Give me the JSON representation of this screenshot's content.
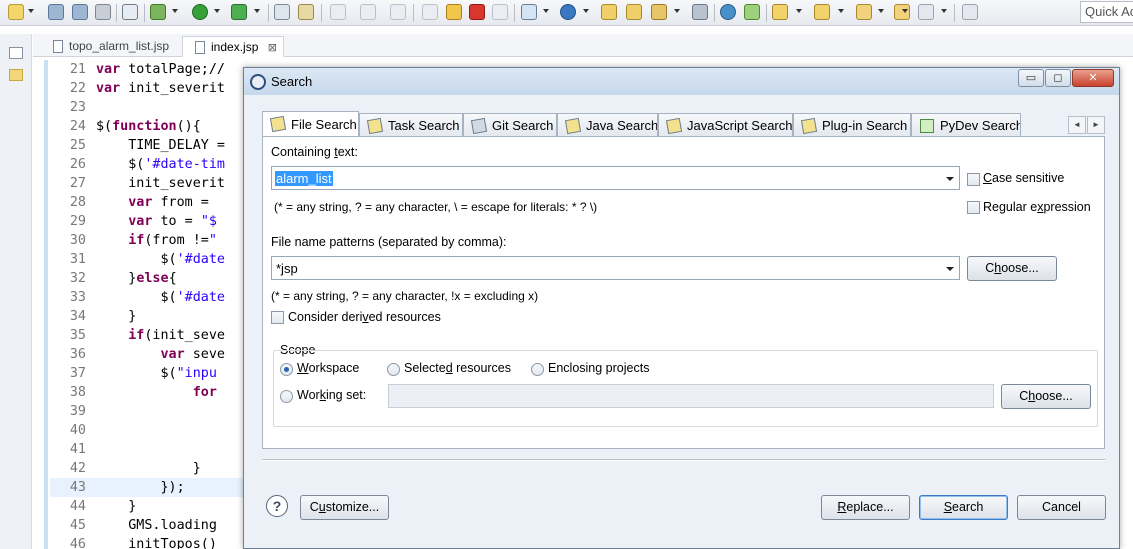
{
  "toolbar": {
    "quick_access": "Quick Ac"
  },
  "editor": {
    "tabs": [
      {
        "label": "topo_alarm_list.jsp"
      },
      {
        "label": "index.jsp",
        "close": "⊠"
      }
    ],
    "lines": [
      {
        "num": "21",
        "code": "var totalPage;//"
      },
      {
        "num": "22",
        "code": "var init_severit"
      },
      {
        "num": "23",
        "code": ""
      },
      {
        "num": "24",
        "code": "$(function(){"
      },
      {
        "num": "25",
        "code": "    TIME_DELAY ="
      },
      {
        "num": "26",
        "code": "    $('#date-tim"
      },
      {
        "num": "27",
        "code": "    init_severit"
      },
      {
        "num": "28",
        "code": "    var from ="
      },
      {
        "num": "29",
        "code": "    var to = \"$"
      },
      {
        "num": "30",
        "code": "    if(from !=\""
      },
      {
        "num": "31",
        "code": "        $('#date"
      },
      {
        "num": "32",
        "code": "    }else{"
      },
      {
        "num": "33",
        "code": "        $('#date"
      },
      {
        "num": "34",
        "code": "    }"
      },
      {
        "num": "35",
        "code": "    if(init_seve"
      },
      {
        "num": "36",
        "code": "        var seve"
      },
      {
        "num": "37",
        "code": "        $(\"inpu"
      },
      {
        "num": "38",
        "code": "            for"
      },
      {
        "num": "39",
        "code": ""
      },
      {
        "num": "40",
        "code": ""
      },
      {
        "num": "41",
        "code": ""
      },
      {
        "num": "42",
        "code": "            }"
      },
      {
        "num": "43",
        "code": "        });"
      },
      {
        "num": "44",
        "code": "    }"
      },
      {
        "num": "45",
        "code": "    GMS.loading"
      },
      {
        "num": "46",
        "code": "    initTopos()"
      }
    ]
  },
  "dialog": {
    "title": "Search",
    "window_buttons": {
      "minimize": "▭",
      "maximize": "◻",
      "close": "✕"
    },
    "tabs": [
      {
        "label": "File Search",
        "active": true
      },
      {
        "label": "Task Search"
      },
      {
        "label": "Git Search"
      },
      {
        "label": "Java Search"
      },
      {
        "label": "JavaScript Search"
      },
      {
        "label": "Plug-in Search"
      },
      {
        "label": "PyDev Search"
      }
    ],
    "tab_scroll": {
      "left": "◄",
      "right": "►"
    },
    "containing_text": {
      "label_pre": "Containing ",
      "label_u": "t",
      "label_post": "ext:",
      "value": "alarm_list",
      "hint": "(* = any string, ? = any character, \\ = escape for literals: * ? \\)"
    },
    "case_sensitive": {
      "u": "C",
      "rest": "ase sensitive",
      "checked": false
    },
    "regular_expression": {
      "pre": "Regular e",
      "u": "x",
      "rest": "pression",
      "checked": false
    },
    "file_patterns": {
      "label": "File name patterns (separated by comma):",
      "value": "*jsp",
      "hint": "(* = any string, ? = any character, !x = excluding x)",
      "choose_pre": "C",
      "choose_u": "h",
      "choose_post": "oose..."
    },
    "derived": {
      "pre": "Consider deri",
      "u": "v",
      "post": "ed resources",
      "checked": false
    },
    "scope": {
      "label": "Scope",
      "workspace": {
        "u": "W",
        "rest": "orkspace",
        "selected": true
      },
      "selected_resources": {
        "pre": "Selecte",
        "u": "d",
        "post": " resources"
      },
      "enclosing_projects": {
        "pre": "Enclosing pro",
        "u": "j",
        "post": "ects"
      },
      "working_set": {
        "pre": "Wor",
        "u": "k",
        "post": "ing set:",
        "value": ""
      },
      "choose_pre": "C",
      "choose_u": "h",
      "choose_post": "oose..."
    },
    "buttons": {
      "help": "?",
      "customize": {
        "pre": "C",
        "u": "u",
        "post": "stomize..."
      },
      "replace": {
        "pre": "",
        "u": "R",
        "post": "eplace..."
      },
      "search": {
        "pre": "",
        "u": "S",
        "post": "earch"
      },
      "cancel": "Cancel"
    }
  },
  "colors": {
    "dialog_bg": "#ecf1f8",
    "selection": "#3399ff",
    "keyword": "#7f0055",
    "string": "#2a00ff"
  }
}
